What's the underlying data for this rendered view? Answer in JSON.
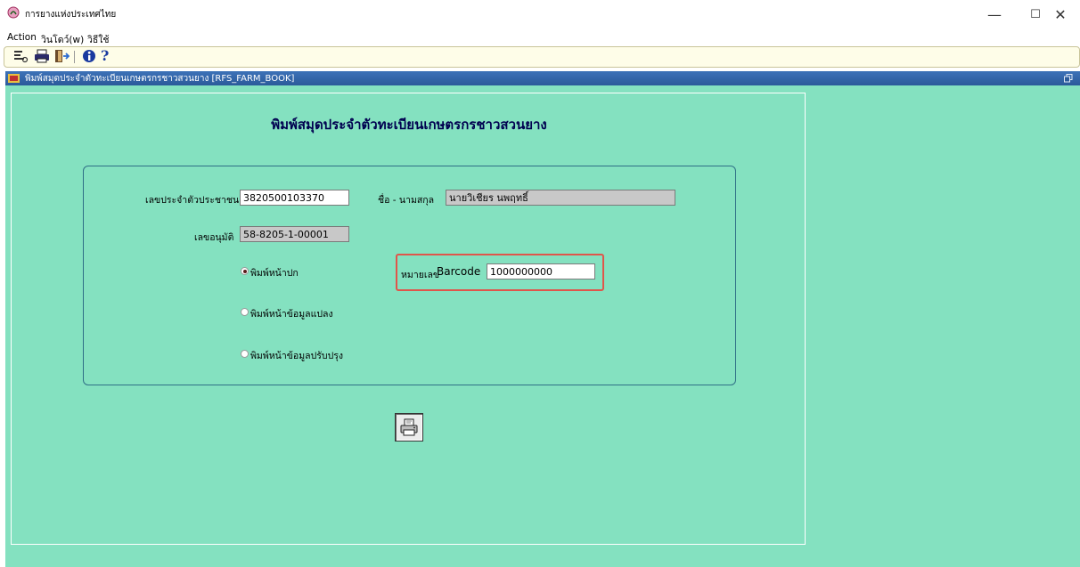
{
  "window": {
    "title": "การยางแห่งประเทศไทย",
    "minimize_glyph": "—",
    "maximize_glyph": "☐",
    "close_glyph": "✕"
  },
  "menu": {
    "items": [
      "Action",
      "วินโดว์(w)",
      "วิธีใช้"
    ]
  },
  "toolbar": {
    "icons": [
      "form-icon",
      "print-icon",
      "exit-icon",
      "info-icon",
      "help-icon"
    ],
    "help_glyph": "?"
  },
  "form_window": {
    "title": "พิมพ์สมุดประจำตัวทะเบียนเกษตรกรชาวสวนยาง [RFS_FARM_BOOK]"
  },
  "form": {
    "heading": "พิมพ์สมุดประจำตัวทะเบียนเกษตรกรชาวสวนยาง",
    "id_card_label": "เลขประจำตัวประชาชน",
    "id_card_value": "3820500103370",
    "name_label": "ชื่อ - นามสกุล",
    "name_value": "นายวิเชียร นพฤทธิ์",
    "approval_label": "เลขอนุมัติ",
    "approval_value": "58-8205-1-00001",
    "radio_options": [
      {
        "label": "พิมพ์หน้าปก",
        "checked": true
      },
      {
        "label": "พิมพ์หน้าข้อมูลแปลง",
        "checked": false
      },
      {
        "label": "พิมพ์หน้าข้อมูลปรับปรุง",
        "checked": false
      }
    ],
    "barcode_label_th": "หมายเลข",
    "barcode_label_en": "Barcode",
    "barcode_value": "1000000000"
  },
  "colors": {
    "canvas": "#84e1c0",
    "title_bar": "#2b5a9a",
    "highlight": "#e0554a",
    "heading_text": "#000050"
  }
}
